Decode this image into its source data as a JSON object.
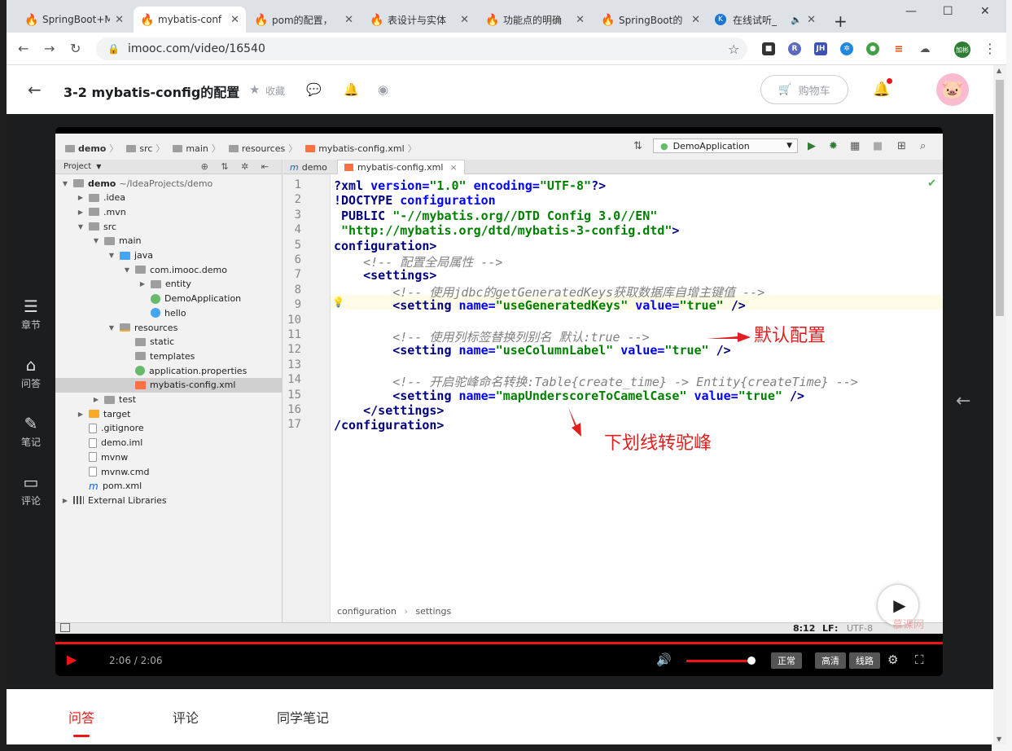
{
  "browser": {
    "tabs": [
      {
        "title": "SpringBoot+M",
        "active": false
      },
      {
        "title": "mybatis-conf",
        "active": true
      },
      {
        "title": "pom的配置，",
        "active": false
      },
      {
        "title": "表设计与实体",
        "active": false
      },
      {
        "title": "功能点的明确",
        "active": false
      },
      {
        "title": "SpringBoot的",
        "active": false
      },
      {
        "title": "在线试听_",
        "active": false
      }
    ],
    "url": "imooc.com/video/16540",
    "profile_label": "加彬",
    "ext_labels": [
      "R",
      "JH"
    ]
  },
  "header": {
    "title": "3-2 mybatis-config的配置",
    "favorite_label": "收藏",
    "cart_label": "购物车"
  },
  "left_nav": {
    "items": [
      {
        "label": "章节"
      },
      {
        "label": "问答"
      },
      {
        "label": "笔记"
      },
      {
        "label": "评论"
      }
    ]
  },
  "ide": {
    "nav_crumbs": [
      "demo",
      "src",
      "main",
      "resources",
      "mybatis-config.xml"
    ],
    "run_config": "DemoApplication",
    "project_label": "Project",
    "tree": [
      {
        "label": "demo",
        "suffix": "~/IdeaProjects/demo",
        "depth": 0,
        "arrow": "down",
        "icon": "folder",
        "bold": true
      },
      {
        "label": ".idea",
        "depth": 1,
        "arrow": "right",
        "icon": "folder"
      },
      {
        "label": ".mvn",
        "depth": 1,
        "arrow": "right",
        "icon": "folder"
      },
      {
        "label": "src",
        "depth": 1,
        "arrow": "down",
        "icon": "folder"
      },
      {
        "label": "main",
        "depth": 2,
        "arrow": "down",
        "icon": "folder"
      },
      {
        "label": "java",
        "depth": 3,
        "arrow": "down",
        "icon": "src"
      },
      {
        "label": "com.imooc.demo",
        "depth": 4,
        "arrow": "down",
        "icon": "folder"
      },
      {
        "label": "entity",
        "depth": 5,
        "arrow": "right",
        "icon": "folder"
      },
      {
        "label": "DemoApplication",
        "depth": 5,
        "arrow": "",
        "icon": "spring"
      },
      {
        "label": "hello",
        "depth": 5,
        "arrow": "",
        "icon": "class"
      },
      {
        "label": "resources",
        "depth": 3,
        "arrow": "down",
        "icon": "res"
      },
      {
        "label": "static",
        "depth": 4,
        "arrow": "",
        "icon": "folder"
      },
      {
        "label": "templates",
        "depth": 4,
        "arrow": "",
        "icon": "folder"
      },
      {
        "label": "application.properties",
        "depth": 4,
        "arrow": "",
        "icon": "spring"
      },
      {
        "label": "mybatis-config.xml",
        "depth": 4,
        "arrow": "",
        "icon": "xml",
        "selected": true
      },
      {
        "label": "test",
        "depth": 2,
        "arrow": "right",
        "icon": "folder"
      },
      {
        "label": "target",
        "depth": 1,
        "arrow": "right",
        "icon": "target"
      },
      {
        "label": ".gitignore",
        "depth": 1,
        "arrow": "",
        "icon": "file"
      },
      {
        "label": "demo.iml",
        "depth": 1,
        "arrow": "",
        "icon": "file"
      },
      {
        "label": "mvnw",
        "depth": 1,
        "arrow": "",
        "icon": "file"
      },
      {
        "label": "mvnw.cmd",
        "depth": 1,
        "arrow": "",
        "icon": "file"
      },
      {
        "label": "pom.xml",
        "depth": 1,
        "arrow": "",
        "icon": "m"
      },
      {
        "label": "External Libraries",
        "depth": 0,
        "arrow": "right",
        "icon": "lib"
      }
    ],
    "editor_tabs": [
      {
        "label": "demo",
        "active": false
      },
      {
        "label": "mybatis-config.xml",
        "active": true
      }
    ],
    "line_numbers": [
      "1",
      "2",
      "3",
      "4",
      "5",
      "6",
      "7",
      "8",
      "9",
      "10",
      "11",
      "12",
      "13",
      "14",
      "15",
      "16",
      "17"
    ],
    "code": [
      [
        {
          "t": "?xml ",
          "c": "tag"
        },
        {
          "t": "version=",
          "c": "attr"
        },
        {
          "t": "\"1.0\" ",
          "c": "str"
        },
        {
          "t": "encoding=",
          "c": "attr"
        },
        {
          "t": "\"UTF-8\"",
          "c": "str"
        },
        {
          "t": "?>",
          "c": "tag"
        }
      ],
      [
        {
          "t": "!DOCTYPE ",
          "c": "tag"
        },
        {
          "t": "configuration",
          "c": "attr"
        }
      ],
      [
        {
          "t": " PUBLIC ",
          "c": "tag"
        },
        {
          "t": "\"-//mybatis.org//DTD Config 3.0//EN\"",
          "c": "str"
        }
      ],
      [
        {
          "t": " \"http://mybatis.org/dtd/mybatis-3-config.dtd\"",
          "c": "str"
        },
        {
          "t": ">",
          "c": "tag"
        }
      ],
      [
        {
          "t": "configuration>",
          "c": "tag"
        }
      ],
      [
        {
          "t": "    <!-- 配置全局属性 -->",
          "c": "cmt"
        }
      ],
      [
        {
          "t": "    <settings>",
          "c": "tag"
        }
      ],
      [
        {
          "t": "        <!-- 使用jdbc的getGeneratedKeys获取数据库自增主键值 -->",
          "c": "cmt"
        }
      ],
      [
        {
          "t": "        <setting ",
          "c": "tag"
        },
        {
          "t": "name=",
          "c": "attr"
        },
        {
          "t": "\"useGeneratedKeys\" ",
          "c": "str"
        },
        {
          "t": "value=",
          "c": "attr"
        },
        {
          "t": "\"true\" ",
          "c": "str"
        },
        {
          "t": "/>",
          "c": "tag"
        }
      ],
      [
        {
          "t": "",
          "c": "tag"
        }
      ],
      [
        {
          "t": "        <!-- 使用列标签替换列别名 默认:true -->",
          "c": "cmt"
        }
      ],
      [
        {
          "t": "        <setting ",
          "c": "tag"
        },
        {
          "t": "name=",
          "c": "attr"
        },
        {
          "t": "\"useColumnLabel\" ",
          "c": "str"
        },
        {
          "t": "value=",
          "c": "attr"
        },
        {
          "t": "\"true\" ",
          "c": "str"
        },
        {
          "t": "/>",
          "c": "tag"
        }
      ],
      [
        {
          "t": "",
          "c": "tag"
        }
      ],
      [
        {
          "t": "        <!-- 开启驼峰命名转换:Table{create_time} -> Entity{createTime} -->",
          "c": "cmt"
        }
      ],
      [
        {
          "t": "        <setting ",
          "c": "tag"
        },
        {
          "t": "name=",
          "c": "attr"
        },
        {
          "t": "\"mapUnderscoreToCamelCase\" ",
          "c": "str"
        },
        {
          "t": "value=",
          "c": "attr"
        },
        {
          "t": "\"true\" ",
          "c": "str"
        },
        {
          "t": "/>",
          "c": "tag"
        }
      ],
      [
        {
          "t": "    </settings>",
          "c": "tag"
        }
      ],
      [
        {
          "t": "/configuration>",
          "c": "tag"
        }
      ]
    ],
    "editor_breadcrumb": [
      "configuration",
      "settings"
    ],
    "status": {
      "position": "8:12",
      "line_sep": "LF",
      "encoding": "UTF-8"
    }
  },
  "annotations": {
    "default_config": "默认配置",
    "underscore_to_camel": "下划线转驼峰"
  },
  "player": {
    "time": "2:06 / 2:06",
    "progress": 1.0,
    "volume": 1.0,
    "quality_buttons": [
      "正常",
      "高清",
      "线路"
    ]
  },
  "bottom_tabs": [
    {
      "label": "问答",
      "active": true
    },
    {
      "label": "评论",
      "active": false
    },
    {
      "label": "同学笔记",
      "active": false
    }
  ],
  "colors": {
    "accent": "#f01414",
    "stage_bg": "#1c1d1f",
    "annotation": "#e02020"
  }
}
